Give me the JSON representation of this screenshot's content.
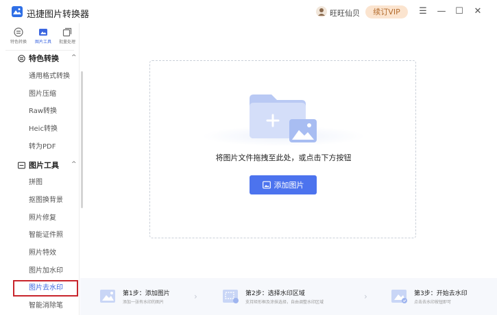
{
  "app": {
    "title": "迅捷图片转换器"
  },
  "user": {
    "name": "旺旺仙贝",
    "vip_label": "续订VIP"
  },
  "window_controls": {
    "menu": "☰",
    "minimize": "—",
    "maximize": "☐",
    "close": "✕"
  },
  "side_tabs": [
    {
      "label": "特色转换",
      "icon": "convert-icon"
    },
    {
      "label": "图片工具",
      "icon": "image-tools-icon"
    },
    {
      "label": "批量处理",
      "icon": "batch-icon"
    }
  ],
  "groups": {
    "convert": {
      "label": "特色转换",
      "items": [
        "通用格式转换",
        "图片压缩",
        "Raw转换",
        "Heic转换",
        "转为PDF"
      ]
    },
    "tools": {
      "label": "图片工具",
      "items": [
        "拼图",
        "抠图换背景",
        "照片修复",
        "智能证件照",
        "照片特效",
        "图片加水印",
        "图片去水印",
        "智能消除笔"
      ]
    }
  },
  "dropzone": {
    "hint": "将图片文件拖拽至此处，或点击下方按钮",
    "add_button": "添加图片"
  },
  "steps": [
    {
      "title": "第1步：添加图片",
      "desc": "添加一张有水印的图片"
    },
    {
      "title": "第2步：选择水印区域",
      "desc": "支持矩形框及涂抹选择，自由调整水印区域"
    },
    {
      "title": "第3步：开始去水印",
      "desc": "点击去水印按钮即可"
    }
  ],
  "colors": {
    "accent": "#4c73ee",
    "vip_bg": "#fbe4cf",
    "selected_outline": "#c8242b"
  }
}
